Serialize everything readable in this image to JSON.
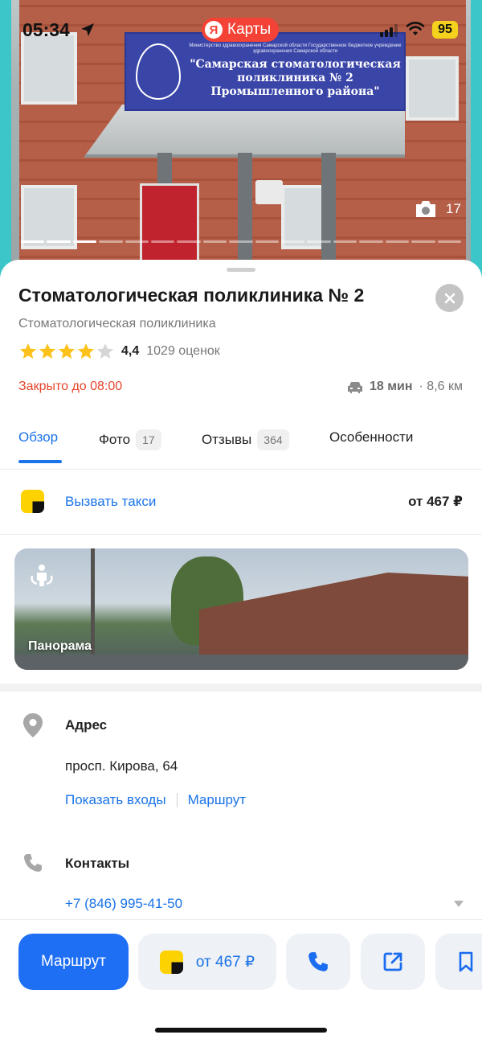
{
  "status_bar": {
    "time": "05:34",
    "battery": "95"
  },
  "brand": {
    "logo_letter": "Я",
    "name": "Карты"
  },
  "photo": {
    "count": "17",
    "sign_small": "Министерство здравоохранения Самарской области Государственное бюджетное учреждение здравоохранения Самарской области",
    "sign_big": "\"Самарская стоматологическая поликлиника № 2 Промышленного района\""
  },
  "place": {
    "title": "Стоматологическая поликлиника № 2",
    "category": "Стоматологическая поликлиника",
    "rating": "4,4",
    "rating_value": 4.4,
    "stars_filled": 4,
    "reviews_count": "1029 оценок",
    "hours": "Закрыто до 08:00",
    "travel_time": "18 мин",
    "travel_distance": "· 8,6 км"
  },
  "tabs": [
    {
      "label": "Обзор",
      "count": ""
    },
    {
      "label": "Фото",
      "count": "17"
    },
    {
      "label": "Отзывы",
      "count": "364"
    },
    {
      "label": "Особенности",
      "count": ""
    }
  ],
  "taxi": {
    "label": "Вызвать такси",
    "price": "от 467 ₽"
  },
  "panorama": {
    "label": "Панорама"
  },
  "address": {
    "heading": "Адрес",
    "value": "просп. Кирова, 64",
    "show_entrances": "Показать входы",
    "route": "Маршрут"
  },
  "contacts": {
    "heading": "Контакты",
    "phone": "+7 (846) 995-41-50"
  },
  "actions": {
    "route": "Маршрут",
    "taxi_price": "от 467 ₽"
  },
  "colors": {
    "accent": "#1f6ff5",
    "link": "#1a73e8",
    "closed": "#e6452d",
    "brand_red": "#f44336",
    "star": "#fcc21b"
  }
}
